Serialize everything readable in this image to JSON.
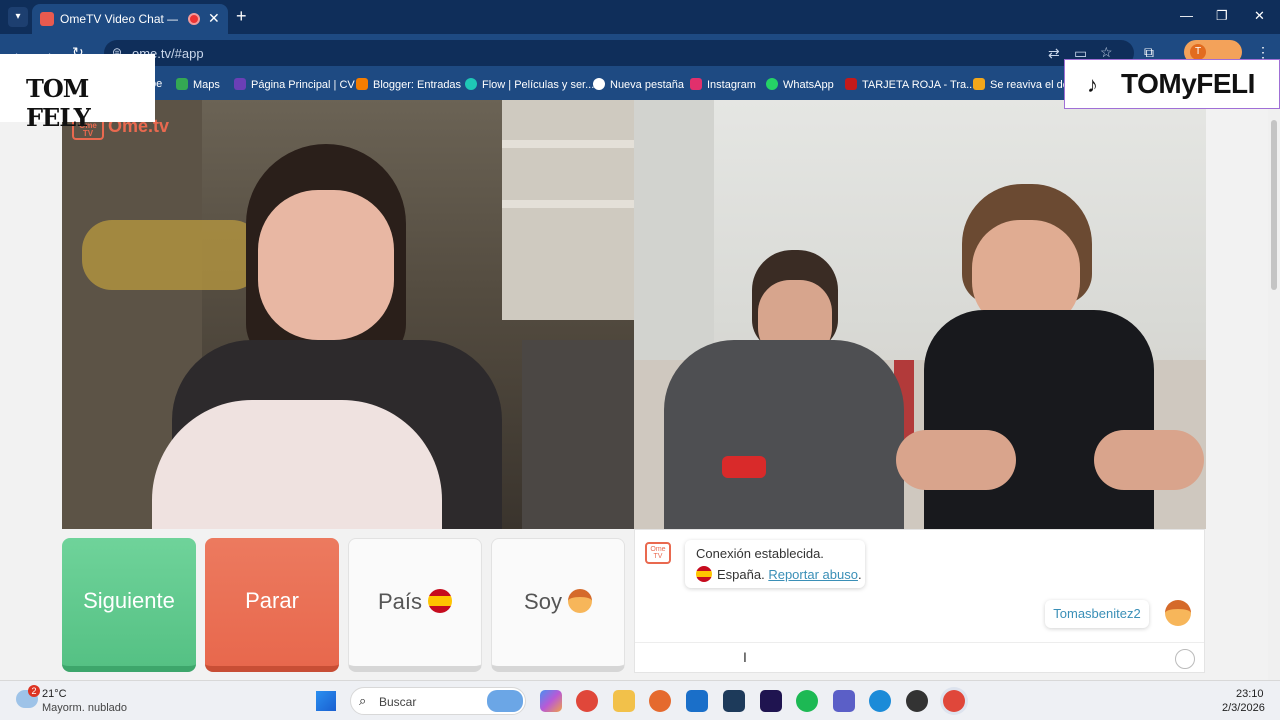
{
  "browser": {
    "tab_title": "OmeTV Video Chat — Ome",
    "new_tab": "+",
    "url": "ome.tv/#app",
    "profile_initial": "T",
    "window_controls": {
      "minimize": "—",
      "maximize": "❐",
      "close": "✕"
    }
  },
  "bookmarks": [
    {
      "label": "pe",
      "color": "#ffffff"
    },
    {
      "label": "Maps",
      "color": "#34a853"
    },
    {
      "label": "Página Principal | CV",
      "color": "#6b3fb6"
    },
    {
      "label": "Blogger: Entradas",
      "color": "#f57d00"
    },
    {
      "label": "Flow | Películas y ser...",
      "color": "#1fc7b6"
    },
    {
      "label": "Nueva pestaña",
      "color": "#ffffff"
    },
    {
      "label": "Instagram",
      "color": "#e1306c"
    },
    {
      "label": "WhatsApp",
      "color": "#25d366"
    },
    {
      "label": "TARJETA ROJA - Tra...",
      "color": "#c41a1a"
    },
    {
      "label": "Se reaviva el deb",
      "color": "#f2a71b"
    }
  ],
  "overlays": {
    "left_logo": "TOM FELY",
    "tiktok_handle": "TOMyFELI"
  },
  "video": {
    "watermark": "Ome.tv",
    "watermark_box": "Ome TV"
  },
  "controls": {
    "next": "Siguiente",
    "stop": "Parar",
    "country": "País",
    "gender": "Soy"
  },
  "chat": {
    "system_line1": "Conexión establecida.",
    "system_country": "España.",
    "report_link": "Reportar abuso",
    "report_suffix": ".",
    "user_message": "Tomasbenitez2"
  },
  "taskbar": {
    "weather_badge": "2",
    "weather_temp": "21°C",
    "weather_desc": "Mayorm. nublado",
    "search_placeholder": "Buscar",
    "time": "23:10",
    "date": "2/3/2026"
  },
  "colors": {
    "next_button": "#55c184",
    "stop_button": "#e8684d",
    "link": "#3a8fb7",
    "browser_frame": "#1e4a82"
  }
}
